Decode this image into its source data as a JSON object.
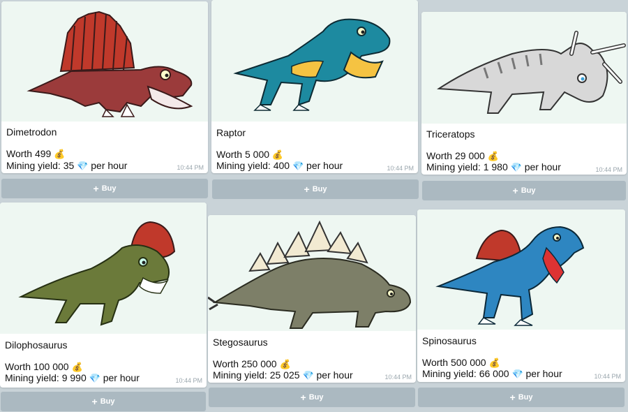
{
  "time": "10:44 PM",
  "buy_label": "Buy",
  "buy_icon": "+",
  "worth_label": "Worth",
  "mining_label": "Mining yield:",
  "per_hour": "per hour",
  "money_icon": "💰",
  "gem_icon": "💎",
  "cards": [
    {
      "name": "Dimetrodon",
      "worth": "499",
      "yield": "35"
    },
    {
      "name": "Raptor",
      "worth": "5 000",
      "yield": "400"
    },
    {
      "name": "Triceratops",
      "worth": "29 000",
      "yield": "1 980"
    },
    {
      "name": "Dilophosaurus",
      "worth": "100 000",
      "yield": "9 990"
    },
    {
      "name": "Stegosaurus",
      "worth": "250 000",
      "yield": "25 025"
    },
    {
      "name": "Spinosaurus",
      "worth": "500 000",
      "yield": "66 000"
    }
  ]
}
